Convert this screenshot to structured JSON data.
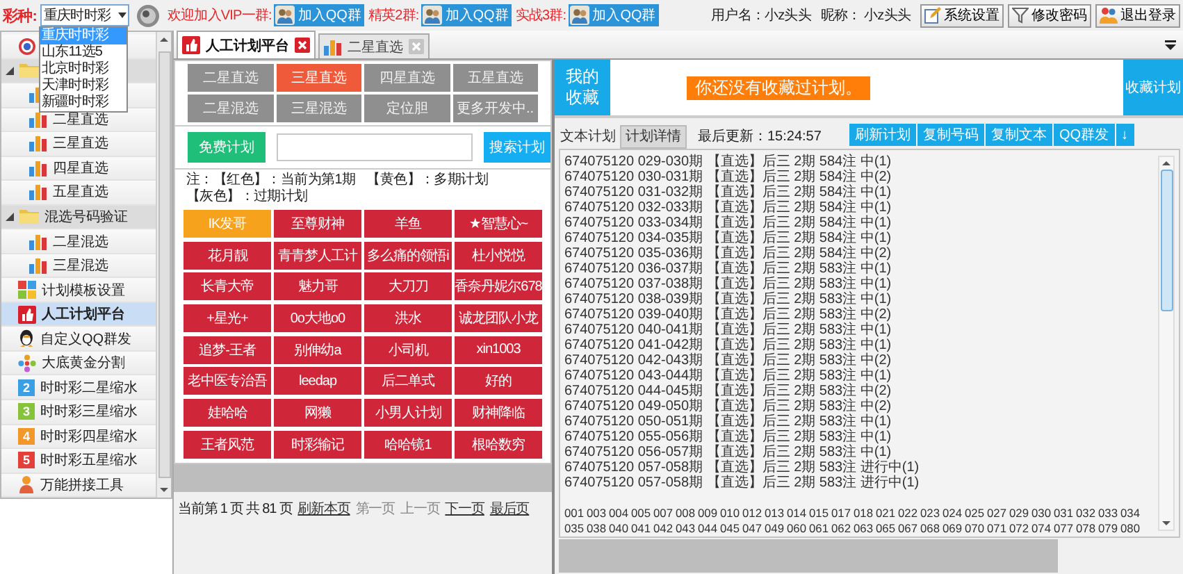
{
  "lottery": {
    "label": "彩种:",
    "value": "重庆时时彩",
    "options": [
      {
        "label": "重庆时时彩",
        "selected": true
      },
      {
        "label": "山东11选5",
        "selected": false
      },
      {
        "label": "北京时时彩",
        "selected": false
      },
      {
        "label": "天津时时彩",
        "selected": false
      },
      {
        "label": "新疆时时彩",
        "selected": false
      }
    ]
  },
  "groups": [
    {
      "label": "欢迎加入VIP一群:",
      "button": "加入QQ群"
    },
    {
      "label": "精英2群:",
      "button": "加入QQ群"
    },
    {
      "label": "实战3群:",
      "button": "加入QQ群"
    }
  ],
  "user": {
    "username_label": "用户名：",
    "username": "小z头头",
    "nickname_label": "昵称：",
    "nickname": "小z头头"
  },
  "toolbar_buttons": [
    "系统设置",
    "修改密码",
    "退出登录"
  ],
  "sidebar": {
    "items": [
      {
        "kind": "target",
        "selected": false
      },
      {
        "kind": "group",
        "expanded": true,
        "selected": false,
        "children": [
          {
            "kind": "bars",
            "selected": false
          },
          {
            "kind": "bars",
            "label": "二星直选",
            "selected": false
          },
          {
            "kind": "bars",
            "label": "三星直选",
            "selected": false
          },
          {
            "kind": "bars",
            "label": "四星直选",
            "selected": false
          },
          {
            "kind": "bars",
            "label": "五星直选",
            "selected": false
          }
        ]
      },
      {
        "kind": "group",
        "label": "混选号码验证",
        "expanded": true,
        "selected": false,
        "children": [
          {
            "kind": "bars",
            "label": "二星混选",
            "selected": false
          },
          {
            "kind": "bars",
            "label": "三星混选",
            "selected": false
          }
        ]
      },
      {
        "kind": "tiles",
        "label": "计划模板设置",
        "selected": false
      },
      {
        "kind": "thumb",
        "label": "人工计划平台",
        "selected": true
      },
      {
        "kind": "penguin",
        "label": "自定义QQ群发",
        "selected": false
      },
      {
        "kind": "dots",
        "label": "大底黄金分割",
        "selected": false
      },
      {
        "kind": "number",
        "badge": "2",
        "color": "#3a9fe4",
        "label": "时时彩二星缩水",
        "selected": false
      },
      {
        "kind": "number",
        "badge": "3",
        "color": "#86c23a",
        "label": "时时彩三星缩水",
        "selected": false
      },
      {
        "kind": "number",
        "badge": "4",
        "color": "#f2972a",
        "label": "时时彩四星缩水",
        "selected": false
      },
      {
        "kind": "number",
        "badge": "5",
        "color": "#e2403a",
        "label": "时时彩五星缩水",
        "selected": false
      },
      {
        "kind": "figure",
        "label": "万能拼接工具",
        "selected": false
      }
    ]
  },
  "tabs": [
    {
      "label": "人工计划平台",
      "kind": "thumb",
      "selected": true
    },
    {
      "label": "二星直选",
      "kind": "bars",
      "selected": false
    }
  ],
  "plan_types": [
    {
      "label": "二星直选",
      "selected": false
    },
    {
      "label": "三星直选",
      "selected": true
    },
    {
      "label": "四星直选",
      "selected": false
    },
    {
      "label": "五星直选",
      "selected": false
    },
    {
      "label": "二星混选",
      "selected": false
    },
    {
      "label": "三星混选",
      "selected": false
    },
    {
      "label": "定位胆",
      "selected": false
    },
    {
      "label": "更多开发中..",
      "selected": false
    }
  ],
  "free_button": "免费计划",
  "search_button": "搜索计划",
  "legend": [
    "注：【红色】：当前为第1期",
    "【黄色】：多期计划",
    "【灰色】：过期计划"
  ],
  "plans": [
    {
      "name": "IK发哥",
      "multi": true
    },
    {
      "name": "至尊财神",
      "multi": false
    },
    {
      "name": "羊鱼",
      "multi": false
    },
    {
      "name": "★智慧心~",
      "multi": false
    },
    {
      "name": "花月靓",
      "multi": false
    },
    {
      "name": "青青梦人工计",
      "multi": false
    },
    {
      "name": "多么痛的领悟i",
      "multi": false
    },
    {
      "name": "杜小悦悦",
      "multi": false
    },
    {
      "name": "长青大帝",
      "multi": false
    },
    {
      "name": "魅力哥",
      "multi": false
    },
    {
      "name": "大刀刀",
      "multi": false
    },
    {
      "name": "香奈丹妮尔678",
      "multi": false
    },
    {
      "name": "+星光+",
      "multi": false
    },
    {
      "name": "0o大地o0",
      "multi": false
    },
    {
      "name": "洪水",
      "multi": false
    },
    {
      "name": "诚龙团队小龙",
      "multi": false
    },
    {
      "name": "追梦-王者",
      "multi": false
    },
    {
      "name": "别伸幼a",
      "multi": false
    },
    {
      "name": "小司机",
      "multi": false
    },
    {
      "name": "xin1003",
      "multi": false
    },
    {
      "name": "老中医专治吾",
      "multi": false
    },
    {
      "name": "leedap",
      "multi": false
    },
    {
      "name": "后二单式",
      "multi": false
    },
    {
      "name": "好的",
      "multi": false
    },
    {
      "name": "娃哈哈",
      "multi": false
    },
    {
      "name": "网獭",
      "multi": false
    },
    {
      "name": "小男人计划",
      "multi": false
    },
    {
      "name": "财神降临",
      "multi": false
    },
    {
      "name": "王者风范",
      "multi": false
    },
    {
      "name": "时彩输记",
      "multi": false
    },
    {
      "name": "哈哈镜1",
      "multi": false
    },
    {
      "name": "根哈数穷",
      "multi": false
    }
  ],
  "pager": {
    "info": "当前第 1 页 共 81 页",
    "links": [
      {
        "label": "刷新本页",
        "disabled": false
      },
      {
        "label": "第一页",
        "disabled": true
      },
      {
        "label": "上一页",
        "disabled": true
      },
      {
        "label": "下一页",
        "disabled": false
      },
      {
        "label": "最后页",
        "disabled": false
      }
    ]
  },
  "favorites": {
    "title": "我的收藏",
    "notice": "你还没有收藏过计划。",
    "button": "收藏计划"
  },
  "text_tabs": [
    {
      "label": "文本计划",
      "selected": true
    },
    {
      "label": "计划详情",
      "selected": false
    }
  ],
  "last_update": "最后更新：15:24:57",
  "actions": [
    "刷新计划",
    "复制号码",
    "复制文本",
    "QQ群发",
    "↓"
  ],
  "plan_text": {
    "lines": [
      "674075120 029-030期 【直选】后三 2期 584注 中(1)",
      "674075120 030-031期 【直选】后三 2期 584注 中(2)",
      "674075120 031-032期 【直选】后三 2期 584注 中(1)",
      "674075120 032-033期 【直选】后三 2期 584注 中(1)",
      "674075120 033-034期 【直选】后三 2期 584注 中(1)",
      "674075120 034-035期 【直选】后三 2期 584注 中(1)",
      "674075120 035-036期 【直选】后三 2期 584注 中(2)",
      "674075120 036-037期 【直选】后三 2期 583注 中(1)",
      "674075120 037-038期 【直选】后三 2期 583注 中(1)",
      "674075120 038-039期 【直选】后三 2期 583注 中(1)",
      "674075120 039-040期 【直选】后三 2期 583注 中(2)",
      "674075120 040-041期 【直选】后三 2期 583注 中(1)",
      "674075120 041-042期 【直选】后三 2期 583注 中(1)",
      "674075120 042-043期 【直选】后三 2期 583注 中(2)",
      "674075120 043-044期 【直选】后三 2期 583注 中(1)",
      "674075120 044-045期 【直选】后三 2期 583注 中(2)",
      "674075120 049-050期 【直选】后三 2期 583注 中(2)",
      "674075120 050-051期 【直选】后三 2期 583注 中(1)",
      "674075120 055-056期 【直选】后三 2期 583注 中(1)",
      "674075120 056-057期 【直选】后三 2期 583注 中(1)",
      "674075120 057-058期 【直选】后三 2期 583注 进行中(1)",
      "674075120 057-058期 【直选】后三 2期 583注 进行中(1)"
    ],
    "numbers": "001 003 004 005 007 008 009 010 012 013 014 015 017 018 021 022 023 024 025 027 029 030 031 032 033 034 035 038 040 041 042 043 044 045 047 049 060 061 062 063 065 067 068 069 070 071 072 074 077 078 079 080"
  }
}
